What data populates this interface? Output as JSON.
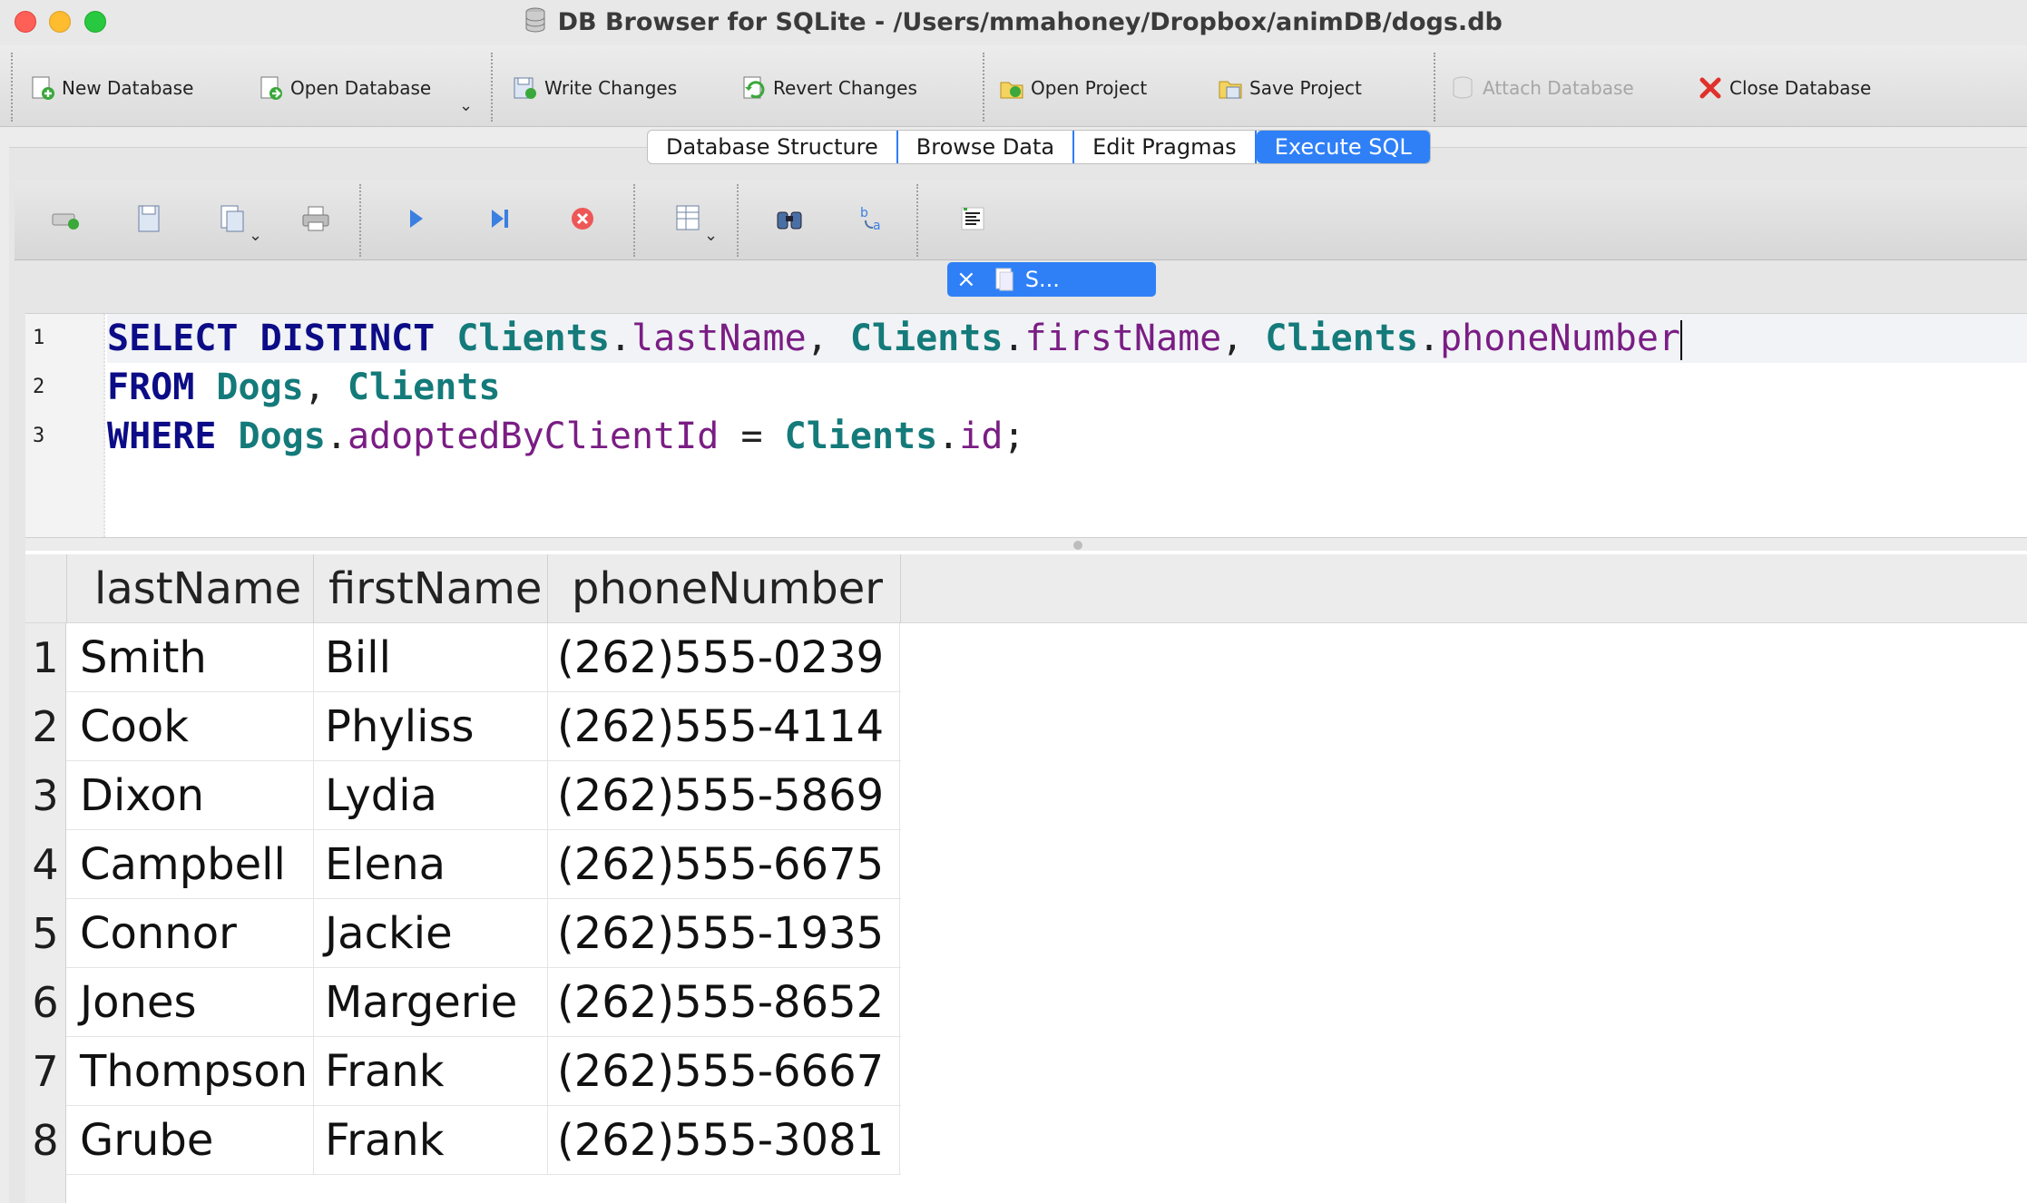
{
  "window": {
    "title": "DB Browser for SQLite - /Users/mmahoney/Dropbox/animDB/dogs.db"
  },
  "toolbar": {
    "new_database": "New Database",
    "open_database": "Open Database",
    "write_changes": "Write Changes",
    "revert_changes": "Revert Changes",
    "open_project": "Open Project",
    "save_project": "Save Project",
    "attach_database": "Attach Database",
    "close_database": "Close Database",
    "chevron": "⌄"
  },
  "tabs": [
    {
      "label": "Database Structure",
      "active": false
    },
    {
      "label": "Browse Data",
      "active": false
    },
    {
      "label": "Edit Pragmas",
      "active": false
    },
    {
      "label": "Execute SQL",
      "active": true
    }
  ],
  "sql_toolbar": {
    "icons": [
      "open-tab-icon",
      "open-sql-file-icon",
      "save-sql-file-icon",
      "print-icon",
      "execute-all-icon",
      "execute-line-icon",
      "stop-execution-icon",
      "save-results-icon",
      "find-icon",
      "find-replace-icon",
      "comment-block-icon"
    ]
  },
  "editor": {
    "tab_close": "×",
    "tab_label": "S...",
    "line_numbers": [
      "1",
      "2",
      "3"
    ],
    "line1": {
      "kw1": "SELECT DISTINCT",
      "t1": "Clients",
      "c1": "lastName",
      "t2": "Clients",
      "c2": "firstName",
      "t3": "Clients",
      "c3": "phoneNumber"
    },
    "line2": {
      "kw": "FROM",
      "t1": "Dogs",
      "t2": "Clients"
    },
    "line3": {
      "kw": "WHERE",
      "t1": "Dogs",
      "c1": "adoptedByClientId",
      "op": "=",
      "t2": "Clients",
      "c2": "id"
    }
  },
  "results": {
    "columns": [
      "lastName",
      "firstName",
      "phoneNumber"
    ],
    "rows": [
      {
        "n": "1",
        "lastName": "Smith",
        "firstName": "Bill",
        "phoneNumber": "(262)555-0239"
      },
      {
        "n": "2",
        "lastName": "Cook",
        "firstName": "Phyliss",
        "phoneNumber": "(262)555-4114"
      },
      {
        "n": "3",
        "lastName": "Dixon",
        "firstName": "Lydia",
        "phoneNumber": "(262)555-5869"
      },
      {
        "n": "4",
        "lastName": "Campbell",
        "firstName": "Elena",
        "phoneNumber": "(262)555-6675"
      },
      {
        "n": "5",
        "lastName": "Connor",
        "firstName": "Jackie",
        "phoneNumber": "(262)555-1935"
      },
      {
        "n": "6",
        "lastName": "Jones",
        "firstName": "Margerie",
        "phoneNumber": "(262)555-8652"
      },
      {
        "n": "7",
        "lastName": "Thompson",
        "firstName": "Frank",
        "phoneNumber": "(262)555-6667"
      },
      {
        "n": "8",
        "lastName": "Grube",
        "firstName": "Frank",
        "phoneNumber": "(262)555-3081"
      }
    ]
  },
  "colors": {
    "accent": "#2f80f7",
    "keyword": "#0c0c87",
    "table": "#147a7a",
    "column": "#7a1d84"
  }
}
